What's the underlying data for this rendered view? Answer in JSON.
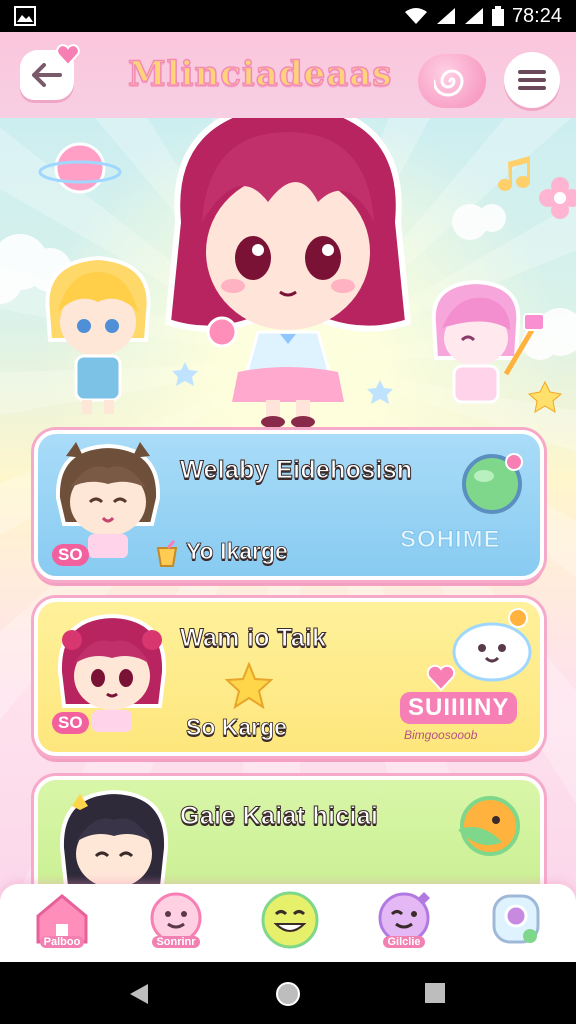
{
  "status_bar": {
    "time": "78:24"
  },
  "header": {
    "title": "Mlinciadeaas"
  },
  "cards": [
    {
      "title": "Welaby Eidehosisn",
      "subtitle": "Yo Ikarge",
      "badge": "SOHIME",
      "tag": "SO"
    },
    {
      "title": "Wam io Taik",
      "subtitle": "So Karge",
      "badge": "SUIIIINY",
      "tag": "SO",
      "small": "Bimgoosooob"
    },
    {
      "title": "Gaie Kaiat hiciai"
    }
  ],
  "bottom_nav": [
    {
      "label": "Palboo",
      "icon": "house-icon"
    },
    {
      "label": "Sonrinr",
      "icon": "smile-face-icon"
    },
    {
      "label": "",
      "icon": "laughing-face-icon"
    },
    {
      "label": "Gilclie",
      "icon": "wink-face-icon"
    },
    {
      "label": "",
      "icon": "camera-pet-icon"
    }
  ],
  "colors": {
    "primary_pink": "#f280b2",
    "header": "#fbc6dc",
    "card_blue": "#a9dcf8",
    "card_yellow": "#fff19b",
    "card_green": "#d9f6a8"
  }
}
